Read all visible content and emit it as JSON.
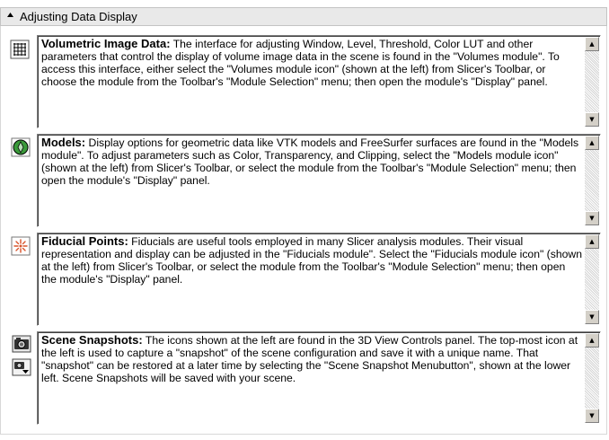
{
  "panel": {
    "title": "Adjusting Data Display",
    "expanded_icon": "collapse-triangle-icon"
  },
  "sections": [
    {
      "heading": "Volumetric Image Data:",
      "body": " The interface for adjusting  Window, Level, Threshold, Color LUT and other parameters that control the display of volume image data in the scene is found in the \"Volumes module\". To access this interface, either select the \"Volumes module icon\" (shown at the left) from Slicer's Toolbar, or choose the module from the Toolbar's \"Module Selection\" menu; then open the module's \"Display\" panel.",
      "icon": "volumes-module-icon"
    },
    {
      "heading": "Models:",
      "body": " Display options for geometric data like VTK models and FreeSurfer surfaces are found in the \"Models module\". To adjust parameters such as Color, Transparency, and Clipping, select the \"Models module icon\" (shown at the left) from Slicer's Toolbar, or select the module from the Toolbar's \"Module Selection\" menu; then open the module's \"Display\" panel.",
      "icon": "models-module-icon"
    },
    {
      "heading": "Fiducial Points:",
      "body": " Fiducials are useful tools employed in many Slicer analysis modules. Their visual representation and display can be adjusted in the \"Fiducials module\". Select the \"Fiducials module icon\" (shown at the left) from Slicer's Toolbar, or select the module from the Toolbar's \"Module Selection\" menu; then open the module's \"Display\" panel.",
      "icon": "fiducials-module-icon"
    },
    {
      "heading": "Scene Snapshots:",
      "body": " The icons shown at the left are found in the 3D View Controls panel. The top-most icon at the left is used to capture a \"snapshot\" of the scene configuration and save it with a unique name. That \"snapshot\" can be restored at a later time by selecting the \"Scene Snapshot Menubutton\", shown at the lower left. Scene Snapshots will be saved with your scene.",
      "icons": [
        "camera-snapshot-icon",
        "scene-snapshot-menubutton-icon"
      ]
    }
  ],
  "scrollbar": {
    "up_glyph": "▲",
    "down_glyph": "▼"
  },
  "colors": {
    "header_bg": "#e9e9e9",
    "scrollbar_bg": "#d4d0c8"
  }
}
